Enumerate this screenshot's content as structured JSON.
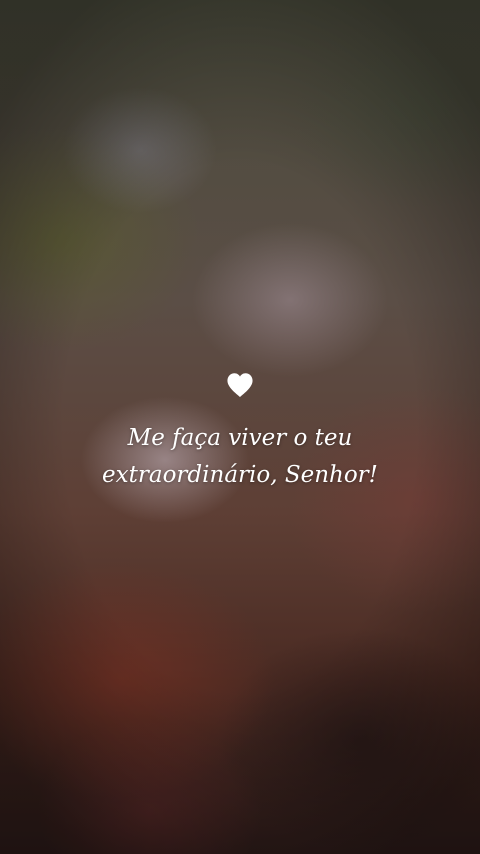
{
  "post": {
    "icon": "heart-icon",
    "quote_line1": "Me faça viver o teu",
    "quote_line2": "extraordinário, Senhor!",
    "text_color": "#ffffff"
  }
}
